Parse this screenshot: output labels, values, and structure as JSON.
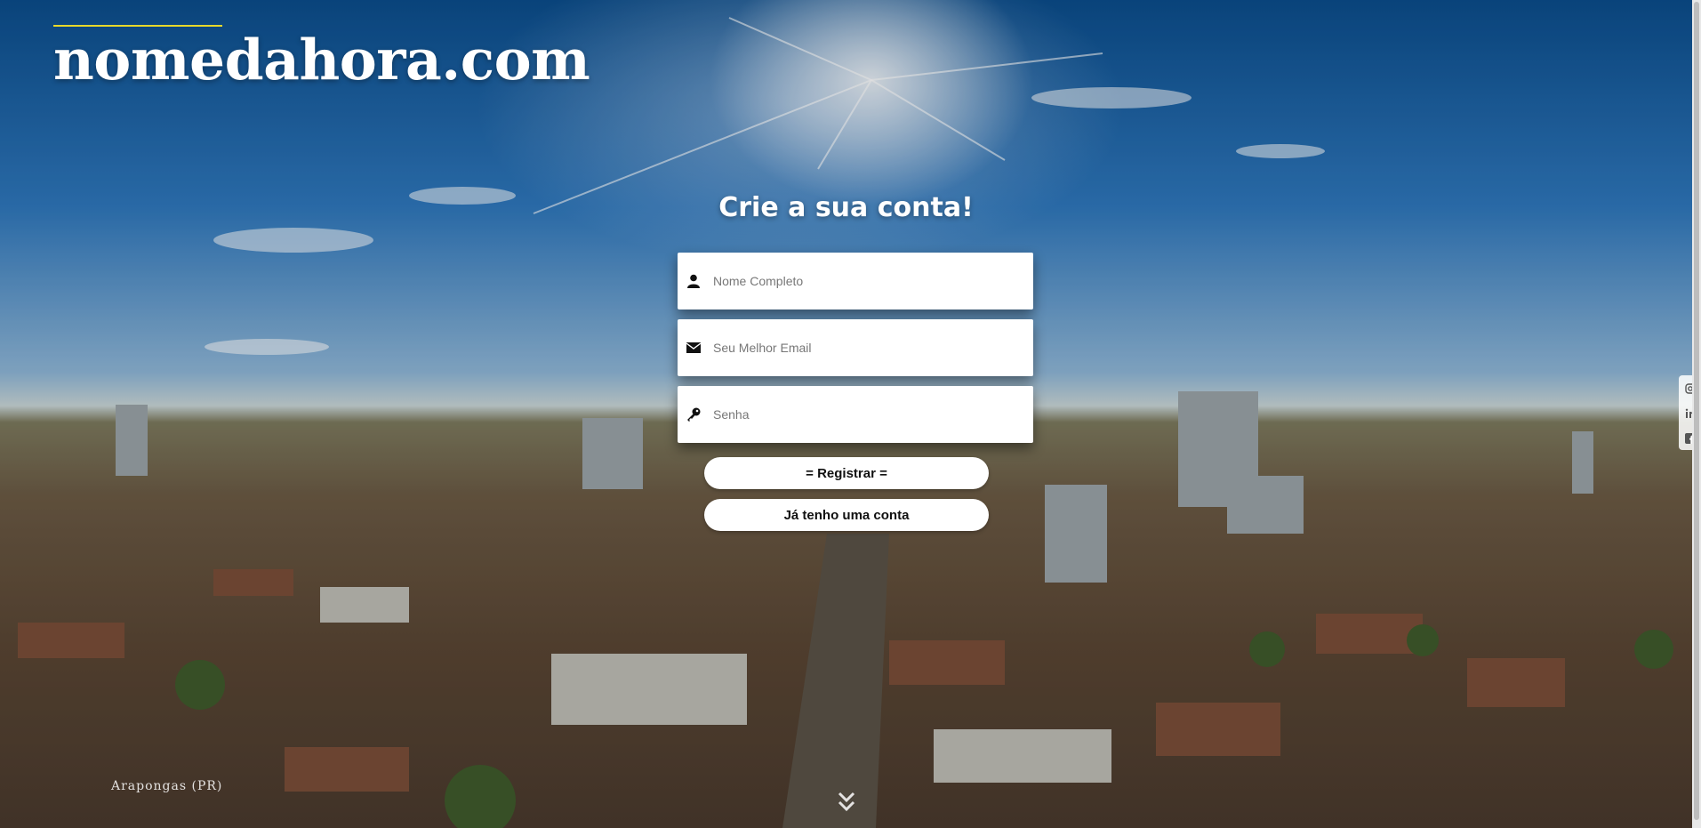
{
  "brand": {
    "logo_text": "nomedahora.com",
    "accent_color": "#e8d92a"
  },
  "form": {
    "title": "Crie a sua conta!",
    "name_placeholder": "Nome Completo",
    "email_placeholder": "Seu Melhor Email",
    "password_placeholder": "Senha",
    "register_label": "= Registrar =",
    "login_label": "Já tenho uma conta"
  },
  "footer": {
    "location_caption": "Arapongas (PR)"
  },
  "icons": {
    "name": "user-icon",
    "email": "envelope-icon",
    "password": "key-icon",
    "scroll": "double-chevron-down-icon",
    "social": [
      "instagram-icon",
      "linkedin-icon",
      "facebook-icon"
    ]
  }
}
